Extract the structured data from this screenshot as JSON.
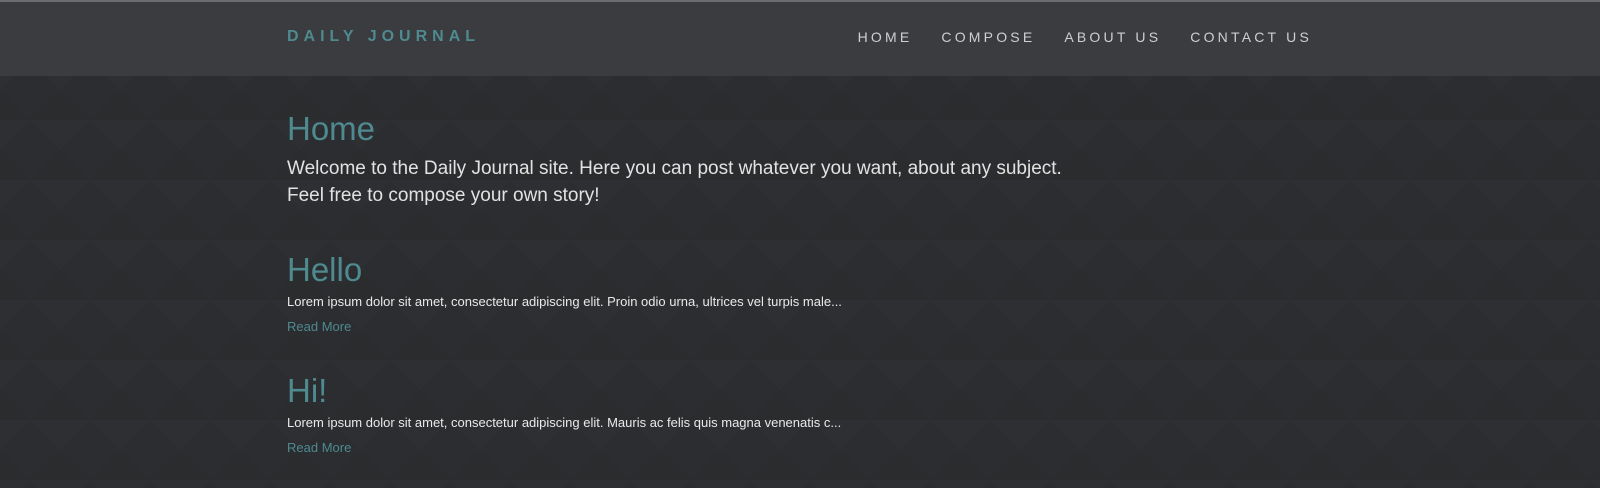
{
  "brand": "DAILY JOURNAL",
  "nav": {
    "home": "HOME",
    "compose": "COMPOSE",
    "about": "ABOUT US",
    "contact": "CONTACT US"
  },
  "page": {
    "title": "Home",
    "intro_line1": "Welcome to the Daily Journal site. Here you can post whatever you want, about any subject.",
    "intro_line2": "Feel free to compose your own story!"
  },
  "posts": [
    {
      "title": "Hello",
      "excerpt": "Lorem ipsum dolor sit amet, consectetur adipiscing elit. Proin odio urna, ultrices vel turpis male...",
      "read_more": "Read More"
    },
    {
      "title": "Hi!",
      "excerpt": "Lorem ipsum dolor sit amet, consectetur adipiscing elit. Mauris ac felis quis magna venenatis c...",
      "read_more": "Read More"
    }
  ],
  "colors": {
    "accent": "#4e8a8f",
    "background": "#2b2d30",
    "navbar": "#3a3c40"
  }
}
